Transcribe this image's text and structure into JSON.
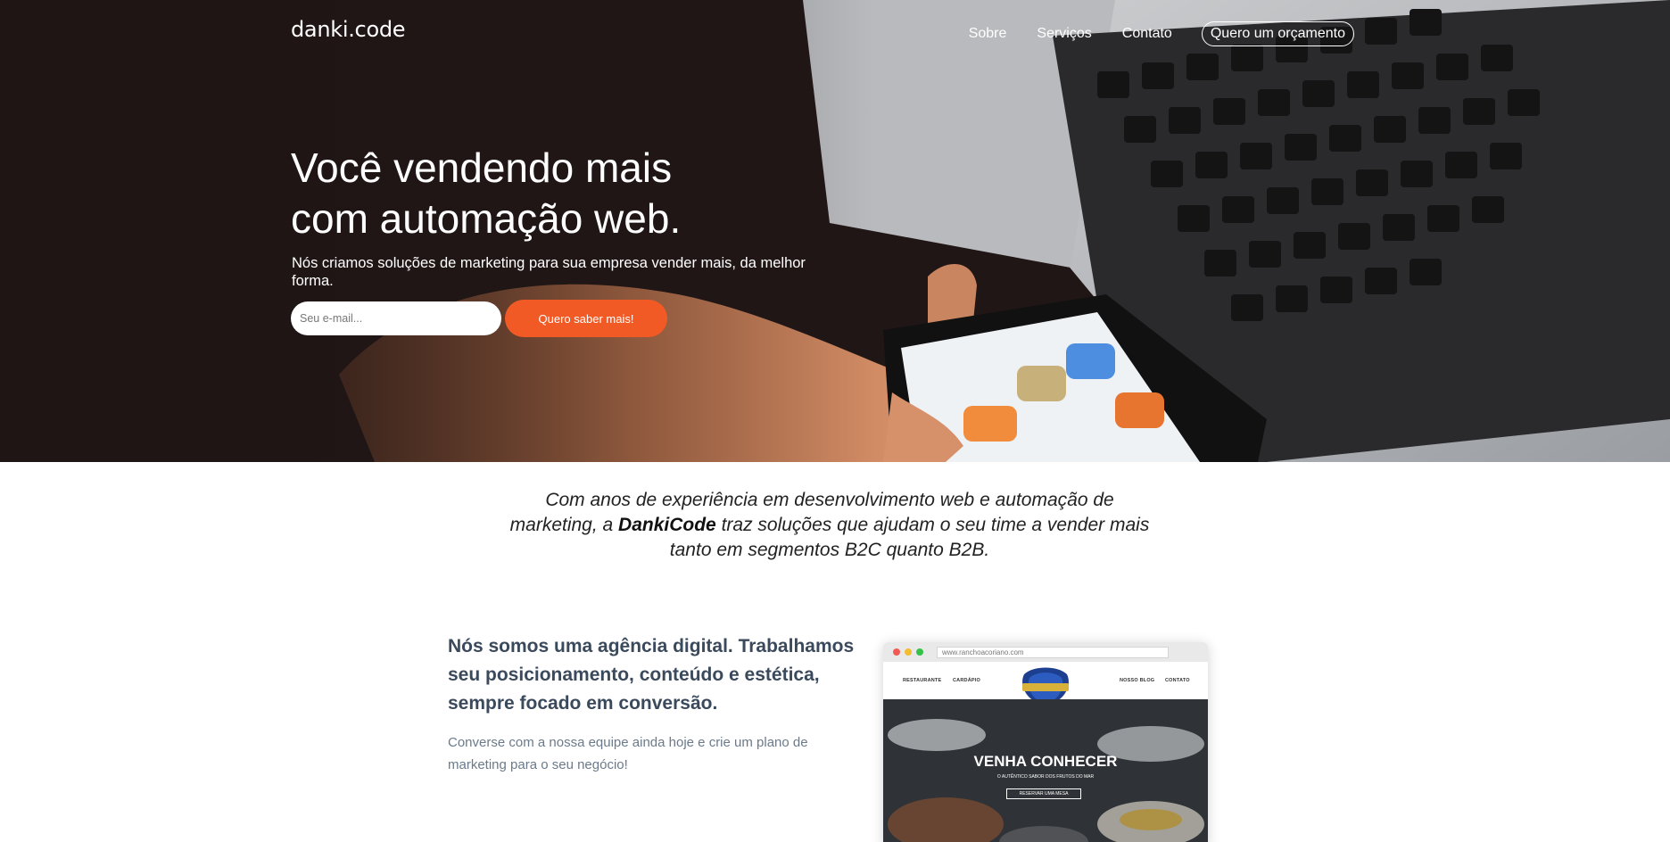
{
  "brand": {
    "logo": "danki.code",
    "accent": "#f15a24"
  },
  "nav": {
    "items": [
      "Sobre",
      "Serviços",
      "Contato"
    ],
    "cta": "Quero um orçamento"
  },
  "hero": {
    "title_line1": "Você vendendo mais",
    "title_line2": "com automação web.",
    "subtitle": "Nós criamos soluções de marketing para sua empresa vender mais, da melhor forma.",
    "email_placeholder": "Seu e-mail...",
    "button": "Quero saber mais!"
  },
  "intro": {
    "before": "Com anos de experiência em desenvolvimento web e automação de marketing, a ",
    "brand": "DankiCode",
    "after": " traz soluções que ajudam o seu time a vender mais tanto em segmentos B2C quanto B2B."
  },
  "agency": {
    "heading": "Nós somos uma agência digital. Trabalhamos seu posicionamento, conteúdo e estética, sempre focado em conversão.",
    "text": "Converse com a nossa equipe ainda hoje e crie um plano de marketing para o seu negócio!"
  },
  "mockup": {
    "url": "www.ranchoacoriano.com",
    "nav": [
      "RESTAURANTE",
      "CARDÁPIO",
      "NOSSO BLOG",
      "CONTATO"
    ],
    "hero_title": "VENHA CONHECER",
    "hero_sub": "O AUTÊNTICO SABOR DOS FRUTOS DO MAR",
    "hero_button": "RESERVAR UMA MESA"
  }
}
